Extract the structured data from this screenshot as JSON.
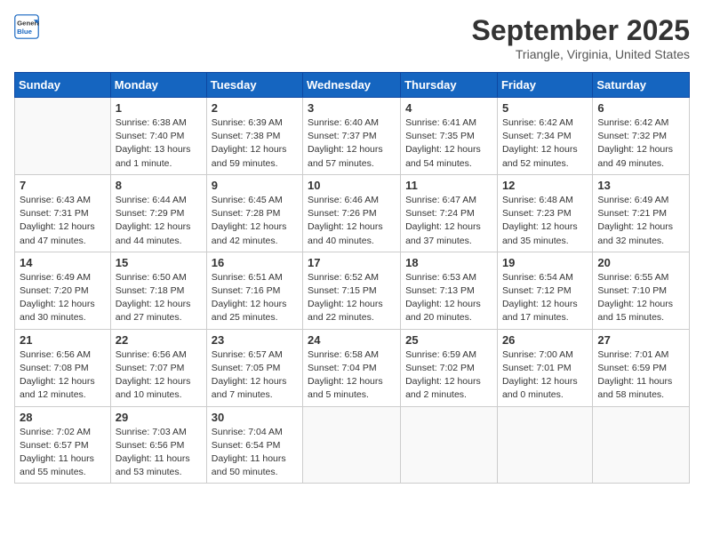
{
  "header": {
    "logo_line1": "General",
    "logo_line2": "Blue",
    "month": "September 2025",
    "location": "Triangle, Virginia, United States"
  },
  "weekdays": [
    "Sunday",
    "Monday",
    "Tuesday",
    "Wednesday",
    "Thursday",
    "Friday",
    "Saturday"
  ],
  "weeks": [
    [
      {
        "day": "",
        "detail": ""
      },
      {
        "day": "1",
        "detail": "Sunrise: 6:38 AM\nSunset: 7:40 PM\nDaylight: 13 hours\nand 1 minute."
      },
      {
        "day": "2",
        "detail": "Sunrise: 6:39 AM\nSunset: 7:38 PM\nDaylight: 12 hours\nand 59 minutes."
      },
      {
        "day": "3",
        "detail": "Sunrise: 6:40 AM\nSunset: 7:37 PM\nDaylight: 12 hours\nand 57 minutes."
      },
      {
        "day": "4",
        "detail": "Sunrise: 6:41 AM\nSunset: 7:35 PM\nDaylight: 12 hours\nand 54 minutes."
      },
      {
        "day": "5",
        "detail": "Sunrise: 6:42 AM\nSunset: 7:34 PM\nDaylight: 12 hours\nand 52 minutes."
      },
      {
        "day": "6",
        "detail": "Sunrise: 6:42 AM\nSunset: 7:32 PM\nDaylight: 12 hours\nand 49 minutes."
      }
    ],
    [
      {
        "day": "7",
        "detail": "Sunrise: 6:43 AM\nSunset: 7:31 PM\nDaylight: 12 hours\nand 47 minutes."
      },
      {
        "day": "8",
        "detail": "Sunrise: 6:44 AM\nSunset: 7:29 PM\nDaylight: 12 hours\nand 44 minutes."
      },
      {
        "day": "9",
        "detail": "Sunrise: 6:45 AM\nSunset: 7:28 PM\nDaylight: 12 hours\nand 42 minutes."
      },
      {
        "day": "10",
        "detail": "Sunrise: 6:46 AM\nSunset: 7:26 PM\nDaylight: 12 hours\nand 40 minutes."
      },
      {
        "day": "11",
        "detail": "Sunrise: 6:47 AM\nSunset: 7:24 PM\nDaylight: 12 hours\nand 37 minutes."
      },
      {
        "day": "12",
        "detail": "Sunrise: 6:48 AM\nSunset: 7:23 PM\nDaylight: 12 hours\nand 35 minutes."
      },
      {
        "day": "13",
        "detail": "Sunrise: 6:49 AM\nSunset: 7:21 PM\nDaylight: 12 hours\nand 32 minutes."
      }
    ],
    [
      {
        "day": "14",
        "detail": "Sunrise: 6:49 AM\nSunset: 7:20 PM\nDaylight: 12 hours\nand 30 minutes."
      },
      {
        "day": "15",
        "detail": "Sunrise: 6:50 AM\nSunset: 7:18 PM\nDaylight: 12 hours\nand 27 minutes."
      },
      {
        "day": "16",
        "detail": "Sunrise: 6:51 AM\nSunset: 7:16 PM\nDaylight: 12 hours\nand 25 minutes."
      },
      {
        "day": "17",
        "detail": "Sunrise: 6:52 AM\nSunset: 7:15 PM\nDaylight: 12 hours\nand 22 minutes."
      },
      {
        "day": "18",
        "detail": "Sunrise: 6:53 AM\nSunset: 7:13 PM\nDaylight: 12 hours\nand 20 minutes."
      },
      {
        "day": "19",
        "detail": "Sunrise: 6:54 AM\nSunset: 7:12 PM\nDaylight: 12 hours\nand 17 minutes."
      },
      {
        "day": "20",
        "detail": "Sunrise: 6:55 AM\nSunset: 7:10 PM\nDaylight: 12 hours\nand 15 minutes."
      }
    ],
    [
      {
        "day": "21",
        "detail": "Sunrise: 6:56 AM\nSunset: 7:08 PM\nDaylight: 12 hours\nand 12 minutes."
      },
      {
        "day": "22",
        "detail": "Sunrise: 6:56 AM\nSunset: 7:07 PM\nDaylight: 12 hours\nand 10 minutes."
      },
      {
        "day": "23",
        "detail": "Sunrise: 6:57 AM\nSunset: 7:05 PM\nDaylight: 12 hours\nand 7 minutes."
      },
      {
        "day": "24",
        "detail": "Sunrise: 6:58 AM\nSunset: 7:04 PM\nDaylight: 12 hours\nand 5 minutes."
      },
      {
        "day": "25",
        "detail": "Sunrise: 6:59 AM\nSunset: 7:02 PM\nDaylight: 12 hours\nand 2 minutes."
      },
      {
        "day": "26",
        "detail": "Sunrise: 7:00 AM\nSunset: 7:01 PM\nDaylight: 12 hours\nand 0 minutes."
      },
      {
        "day": "27",
        "detail": "Sunrise: 7:01 AM\nSunset: 6:59 PM\nDaylight: 11 hours\nand 58 minutes."
      }
    ],
    [
      {
        "day": "28",
        "detail": "Sunrise: 7:02 AM\nSunset: 6:57 PM\nDaylight: 11 hours\nand 55 minutes."
      },
      {
        "day": "29",
        "detail": "Sunrise: 7:03 AM\nSunset: 6:56 PM\nDaylight: 11 hours\nand 53 minutes."
      },
      {
        "day": "30",
        "detail": "Sunrise: 7:04 AM\nSunset: 6:54 PM\nDaylight: 11 hours\nand 50 minutes."
      },
      {
        "day": "",
        "detail": ""
      },
      {
        "day": "",
        "detail": ""
      },
      {
        "day": "",
        "detail": ""
      },
      {
        "day": "",
        "detail": ""
      }
    ]
  ]
}
